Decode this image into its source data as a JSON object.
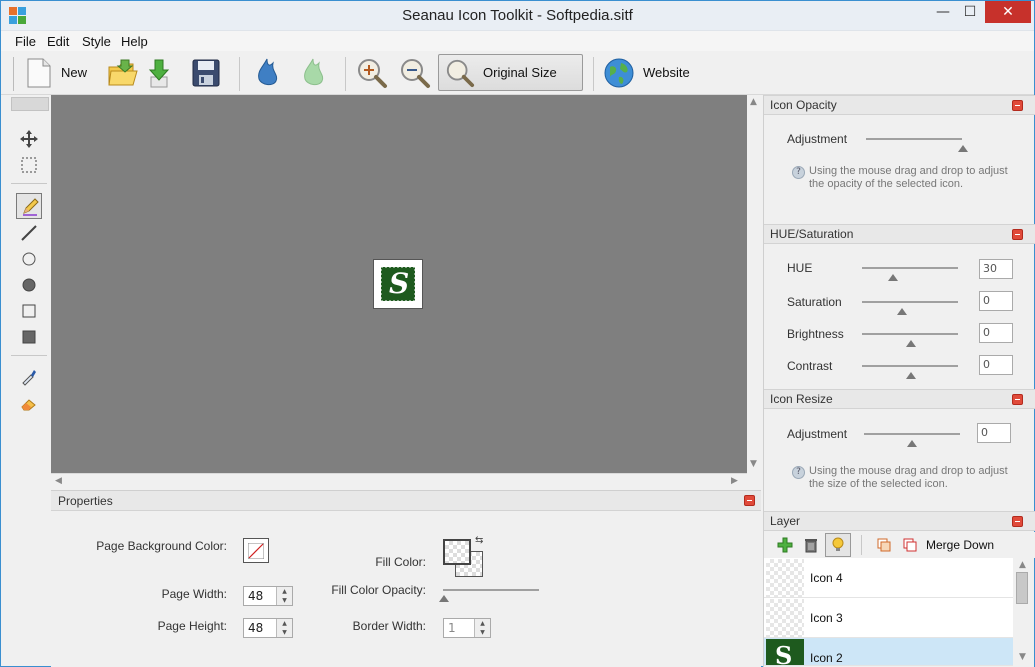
{
  "window": {
    "title": "Seanau Icon Toolkit - Softpedia.sitf",
    "minimize_glyph": "—",
    "maximize_glyph": "☐",
    "close_glyph": "✕"
  },
  "menu": [
    "File",
    "Edit",
    "Style",
    "Help"
  ],
  "toolbar": {
    "new_label": "New",
    "original_size_label": "Original Size",
    "website_label": "Website"
  },
  "canvas": {
    "background_color": "#7f7f7f",
    "icon_letter": "S",
    "icon_color": "#1e5a1e"
  },
  "properties": {
    "title": "Properties",
    "page_bg_label": "Page Background Color:",
    "page_width_label": "Page Width:",
    "page_width_value": "48",
    "page_height_label": "Page Height:",
    "page_height_value": "48",
    "fill_color_label": "Fill Color:",
    "fill_opacity_label": "Fill Color Opacity:",
    "border_width_label": "Border Width:",
    "border_width_value": "1"
  },
  "icon_opacity": {
    "title": "Icon Opacity",
    "adjustment_label": "Adjustment",
    "help": "Using the mouse drag and drop to adjust the opacity of the selected icon."
  },
  "hue_saturation": {
    "title": "HUE/Saturation",
    "rows": [
      {
        "label": "HUE",
        "value": "30"
      },
      {
        "label": "Saturation",
        "value": "0"
      },
      {
        "label": "Brightness",
        "value": "0"
      },
      {
        "label": "Contrast",
        "value": "0"
      }
    ]
  },
  "icon_resize": {
    "title": "Icon Resize",
    "adjustment_label": "Adjustment",
    "value": "0",
    "help": "Using the mouse drag and drop to adjust the size of the selected icon."
  },
  "layer": {
    "title": "Layer",
    "merge_down_label": "Merge Down",
    "items": [
      {
        "name": "Icon 4"
      },
      {
        "name": "Icon 3"
      },
      {
        "name": "Icon 2"
      }
    ]
  }
}
